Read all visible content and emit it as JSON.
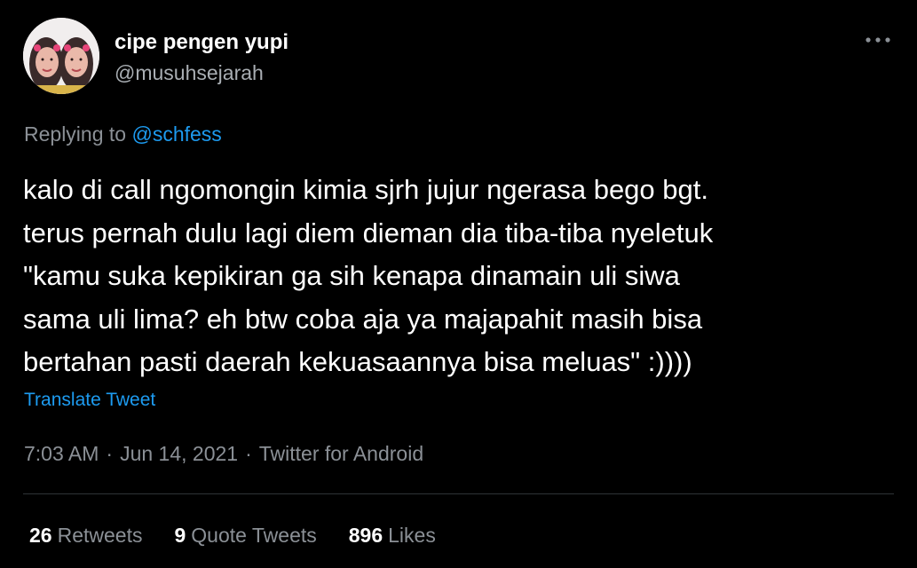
{
  "user": {
    "display_name": "cipe pengen yupi",
    "handle": "@musuhsejarah",
    "avatar_icon": "profile-photo"
  },
  "header": {
    "more_icon": "more-horizontal-icon"
  },
  "reply": {
    "prefix": "Replying to",
    "mention": "@schfess"
  },
  "tweet": {
    "lines": [
      "kalo di call ngomongin kimia sjrh jujur ngerasa bego bgt.",
      "terus pernah dulu lagi diem dieman dia tiba-tiba nyeletuk",
      "\"kamu suka kepikiran ga sih kenapa dinamain uli siwa",
      "sama uli lima? eh btw coba aja ya majapahit masih bisa",
      "bertahan pasti daerah kekuasaannya bisa meluas\" :))))"
    ],
    "translate_label": "Translate Tweet"
  },
  "meta": {
    "time": "7:03 AM",
    "date": "Jun 14, 2021",
    "source": "Twitter for Android",
    "separator": "·"
  },
  "stats": {
    "retweets_count": "26",
    "retweets_label": "Retweets",
    "quotes_count": "9",
    "quotes_label": "Quote Tweets",
    "likes_count": "896",
    "likes_label": "Likes"
  },
  "colors": {
    "background": "#000000",
    "link": "#1d9bf0",
    "muted": "#8b9096",
    "text": "#ffffff"
  }
}
